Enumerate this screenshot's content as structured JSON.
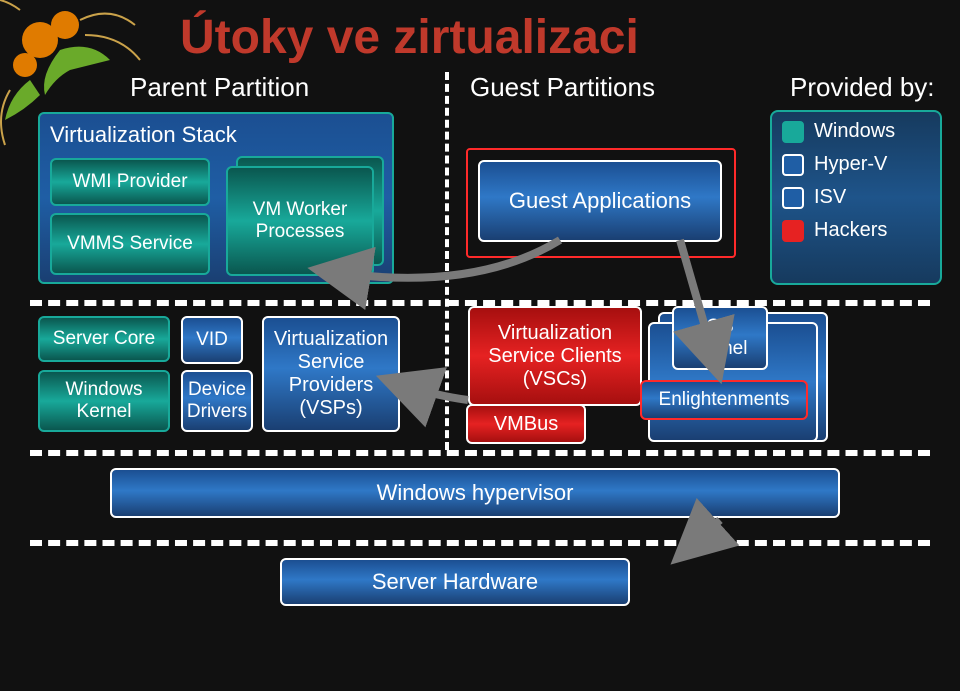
{
  "title": "Útoky ve zirtualizaci",
  "labels": {
    "parent": "Parent Partition",
    "guest": "Guest Partitions",
    "provided": "Provided by:"
  },
  "vstack": {
    "header": "Virtualization Stack",
    "wmi": "WMI Provider",
    "vmms": "VMMS Service",
    "vmw": "VM Worker Processes"
  },
  "guest_app": "Guest Applications",
  "legend": {
    "windows": "Windows",
    "hyperv": "Hyper-V",
    "isv": "ISV",
    "hackers": "Hackers"
  },
  "kernel": {
    "server_core": "Server Core",
    "windows_kernel": "Windows Kernel",
    "vid": "VID",
    "device_drivers": "Device Drivers",
    "vsps": "Virtualization Service Providers (VSPs)",
    "vscs": "Virtualization Service Clients (VSCs)",
    "vmbus": "VMBus",
    "os_kernel": "OS Kernel",
    "enlight": "Enlightenments"
  },
  "hv": "Windows hypervisor",
  "hw": "Server Hardware"
}
